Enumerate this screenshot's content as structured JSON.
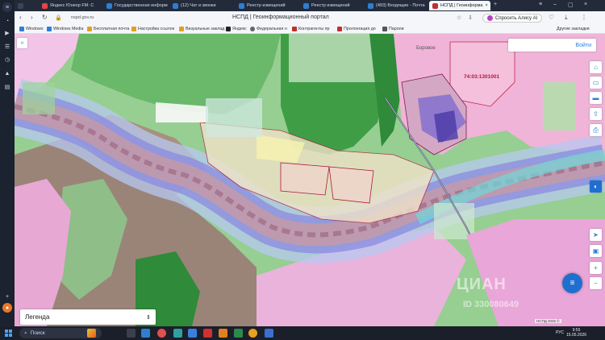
{
  "browser": {
    "tabs": [
      {
        "label": "",
        "color": "#3c4556"
      },
      {
        "label": "Яндекс Юнеор FM: С",
        "color": "#e64545"
      },
      {
        "label": "Государственная информ",
        "color": "#2f7fd0"
      },
      {
        "label": "(12) Чат и звонки",
        "color": "#2f7fd0"
      },
      {
        "label": "Реестр извещений",
        "color": "#2f7fd0"
      },
      {
        "label": "Реестр извещений",
        "color": "#2f7fd0"
      },
      {
        "label": "(493) Входящие - Почта",
        "color": "#2f7fd0"
      },
      {
        "label": "НСПД | Геоинформа",
        "color": "#c03030"
      }
    ],
    "url": "nspd.gov.ru",
    "page_title": "НСПД | Геоинформационный портал",
    "alice_label": "Спросить Алису AI"
  },
  "bookmarks": {
    "items": [
      {
        "label": "Windows",
        "color": "#2f7fd0"
      },
      {
        "label": "Windows Media",
        "color": "#2f7fd0"
      },
      {
        "label": "Бесплатная почта",
        "color": "#e0a020"
      },
      {
        "label": "Настройка ссылок",
        "color": "#e0a020"
      },
      {
        "label": "Визуальные заклад",
        "color": "#e0a020"
      },
      {
        "label": "Яндекс",
        "color": "#222222"
      },
      {
        "label": "Федеральная н",
        "color": "#666666"
      },
      {
        "label": "Контрагенты пр",
        "color": "#c03030"
      },
      {
        "label": "Пролонгация до",
        "color": "#c03030"
      },
      {
        "label": "Пароли",
        "color": "#555555"
      }
    ],
    "other_label": "Другие закладки"
  },
  "map": {
    "login_label": "Войти",
    "cadastral_number": "74:03:1301001",
    "village_label": "Боровое",
    "legend_label": "Легенда",
    "watermark": "ЦИАН",
    "watermark_id": "ID 330080649",
    "copyright": "НСПД 2026 ©"
  },
  "taskbar": {
    "search_placeholder": "Поиск",
    "lang": "РУС",
    "time": "9:55",
    "date": "15.05.2026"
  }
}
